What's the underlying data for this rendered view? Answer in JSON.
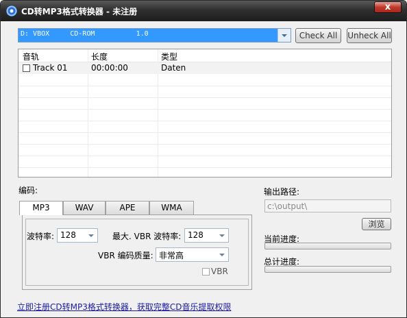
{
  "window": {
    "title": "CD转MP3格式转换器 - 未注册",
    "close_glyph": "x"
  },
  "drive": {
    "selected": "D: VBOX     CD-ROM          1.0"
  },
  "buttons": {
    "check_all": "Check All",
    "uncheck_all": "Unheck All",
    "browse": "浏览"
  },
  "tracklist": {
    "columns": [
      "音轨",
      "长度",
      "类型"
    ],
    "rows": [
      {
        "checked": false,
        "name": "Track 01",
        "length": "00:00:00",
        "type": "Daten"
      }
    ]
  },
  "encoding": {
    "label": "编码:",
    "tabs": [
      "MP3",
      "WAV",
      "APE",
      "WMA"
    ],
    "active_tab": "MP3",
    "bitrate_label": "波特率:",
    "bitrate_value": "128",
    "max_vbr_label": "最大. VBR 波特率:",
    "max_vbr_value": "128",
    "vbr_quality_label": "VBR 编码质量:",
    "vbr_quality_value": "非常高",
    "vbr_checkbox_label": "VBR",
    "vbr_checked": false
  },
  "output": {
    "label": "输出路径:",
    "path": "c:\\output\\"
  },
  "progress": {
    "current_label": "当前进度:",
    "current_value": 0,
    "total_label": "总计进度:",
    "total_value": 0
  },
  "footer": {
    "register_link": "立即注册CD转MP3格式转换器，获取完整CD音乐提取权限"
  }
}
